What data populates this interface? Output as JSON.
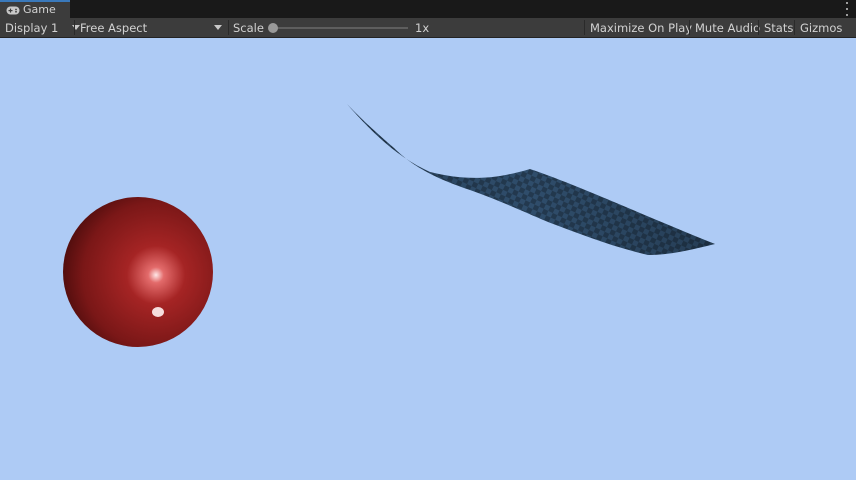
{
  "window": {
    "tab_label": "Game",
    "tab_icon": "gamepad-icon"
  },
  "toolbar": {
    "display": "Display 1",
    "aspect": "Free Aspect",
    "scale_label": "Scale",
    "scale_value": "1x",
    "maximize": "Maximize On Play",
    "mute": "Mute Audio",
    "stats": "Stats",
    "gizmos": "Gizmos"
  },
  "scene": {
    "sky_color": "#aecbf5",
    "sphere_color": "#8b1a1a",
    "cloth_color": "#2c4a6a"
  }
}
